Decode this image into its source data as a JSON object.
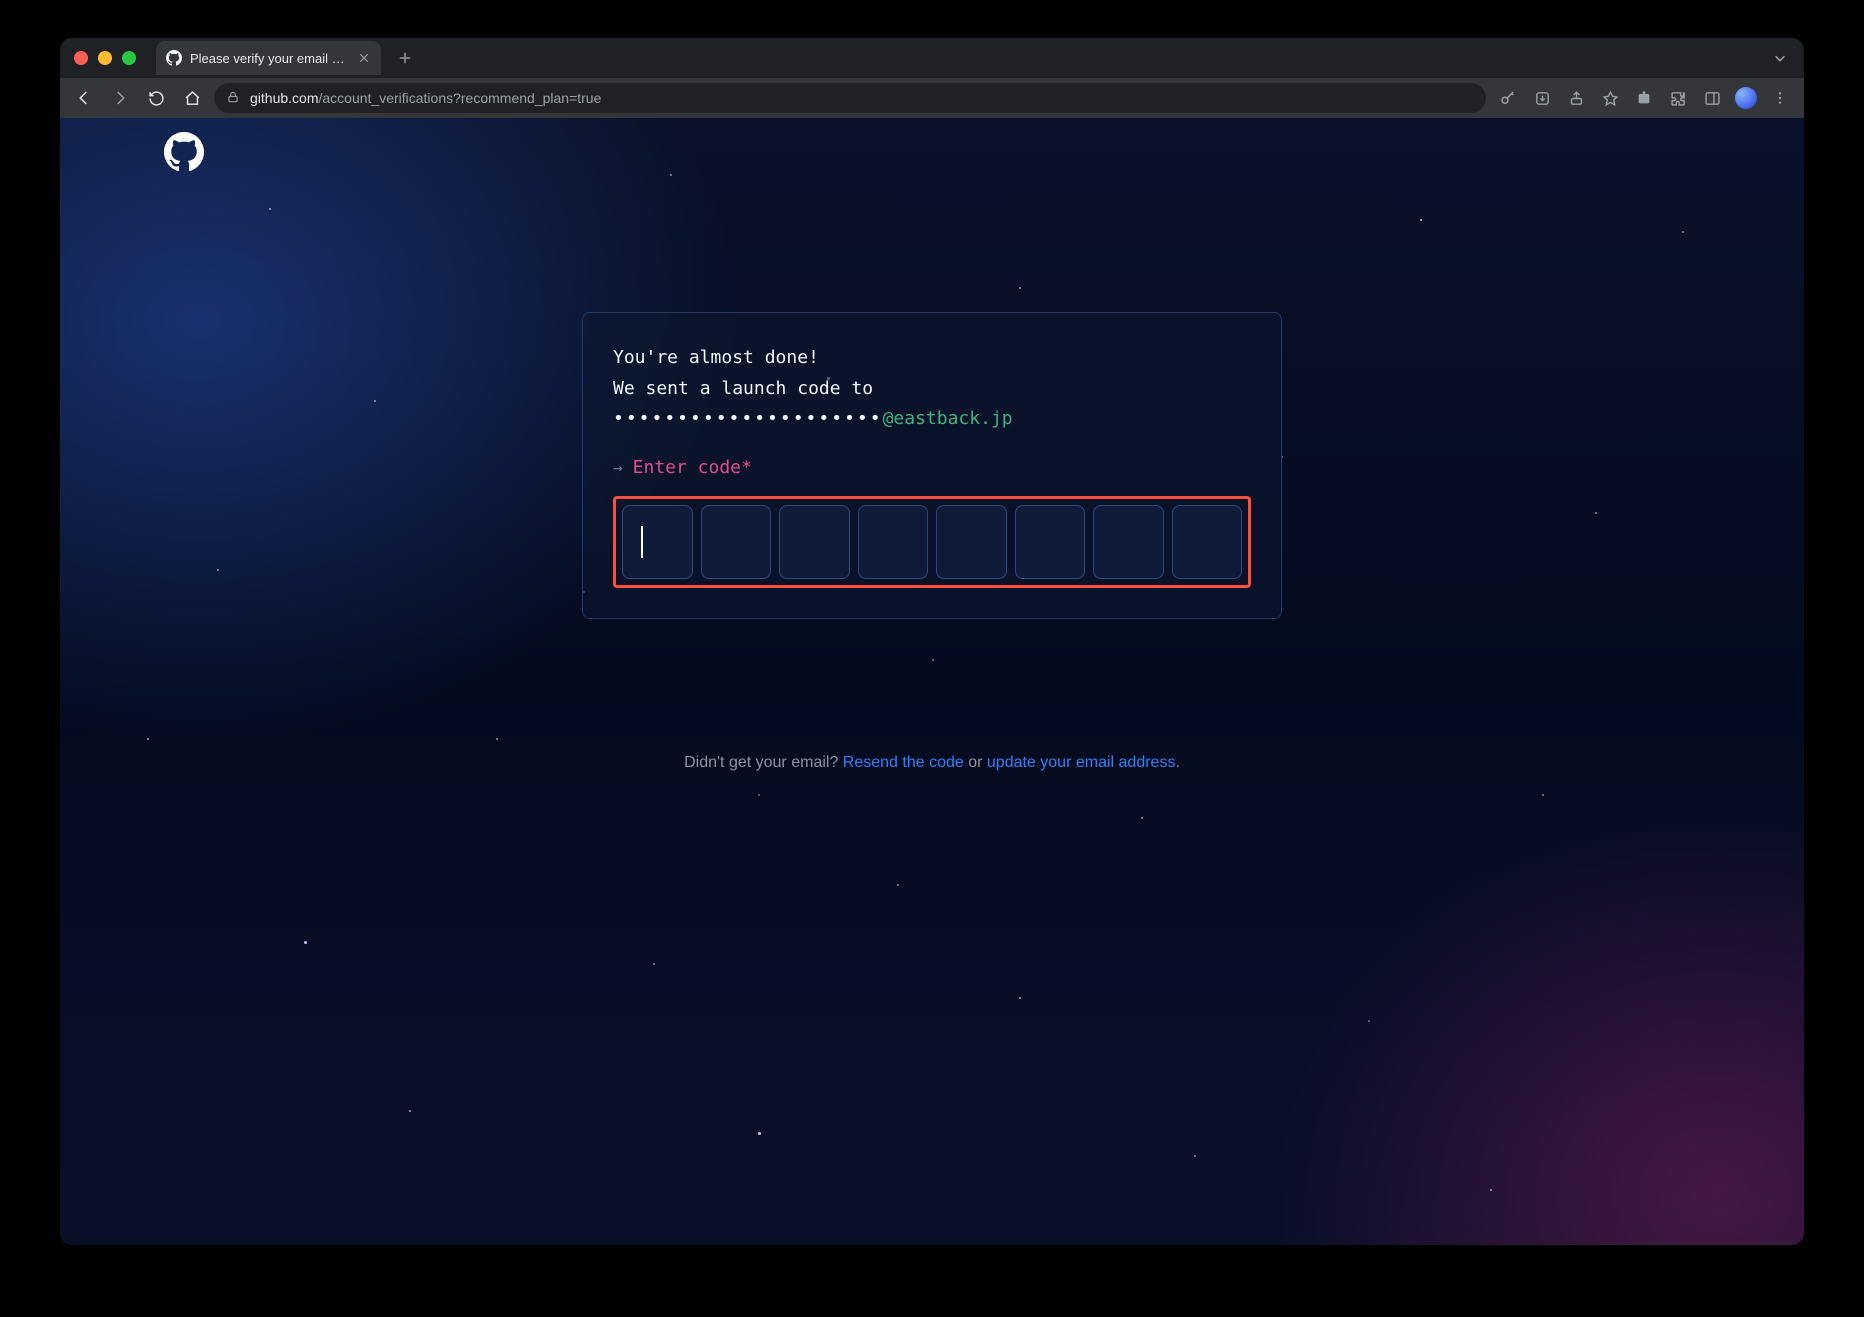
{
  "browser": {
    "tab": {
      "title": "Please verify your email address"
    },
    "url": {
      "domain": "github.com",
      "path": "/account_verifications?recommend_plan=true"
    }
  },
  "page": {
    "heading1": "You're almost done!",
    "heading2": "We sent a launch code to",
    "email_mask": "•••••••••••••••••••••",
    "email_visible": "@eastback.jp",
    "prompt_arrow": "→",
    "prompt_label": "Enter code*",
    "code_length": 8,
    "code_values": [
      "",
      "",
      "",
      "",
      "",
      "",
      "",
      ""
    ],
    "active_index": 0
  },
  "footer": {
    "prefix": "Didn't get your email? ",
    "resend_link": "Resend the code",
    "middle": " or ",
    "update_link": "update your email address",
    "suffix": "."
  },
  "colors": {
    "highlight_border": "#ff4d3d",
    "accent_green": "#3fb27f",
    "accent_pink": "#e44b8d",
    "link_blue": "#2f81f7"
  }
}
